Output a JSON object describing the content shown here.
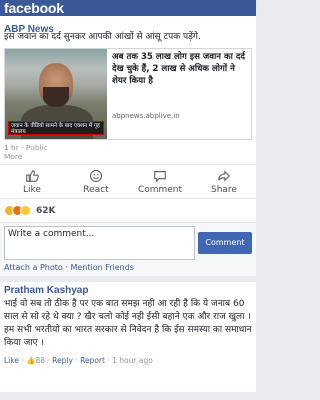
{
  "app": {
    "brand": "facebook"
  },
  "post": {
    "page_name": "ABP News",
    "text": "इस जवान का दर्द सुनकर आपकी आंखों से आंसू टपक पड़ेंगे.",
    "link_card": {
      "title": "अब तक 35 लाख लोग इस जवान का दर्द देख चुके हैं, 2 लाख से अधिक लोगों ने शेयर किया है",
      "domain": "abpnews.abplive.in",
      "caption": "जवान के वीडियो सामने के बाद एक्शन में गृह मंत्रालय"
    },
    "time": "1 hr",
    "privacy": "Public",
    "more_label": "More"
  },
  "actions": {
    "like": "Like",
    "react": "React",
    "comment": "Comment",
    "share": "Share"
  },
  "reactions": {
    "count": "62K",
    "types": [
      "wow-icon",
      "angry-icon",
      "sad-icon"
    ],
    "colors": {
      "wow": "#f7b125",
      "angry": "#e9710f",
      "sad": "#f7c838"
    }
  },
  "composer": {
    "placeholder": "Write a comment...",
    "submit": "Comment",
    "attach_photo": "Attach a Photo",
    "mention_friends": "Mention Friends",
    "separator": "·"
  },
  "comment": {
    "author": "Pratham Kashyap",
    "text": "भाई वो सब तो ठीक है पर एक बात समझ नही आ रही है कि ये जनाब 60 साल से सो रहे थे क्या ? खैर चलो कोई नही ईसी बहाने एक और राज खुला ।हम सभी भरतीयो का भारत सरकार से निवेदन है कि ईस समस्या का समाधान किया जाए ।",
    "like_label": "Like",
    "likes": "88",
    "reply_label": "Reply",
    "report_label": "Report",
    "time": "1 hour ago"
  },
  "colors": {
    "brand": "#3b5998",
    "button": "#4267b2"
  }
}
